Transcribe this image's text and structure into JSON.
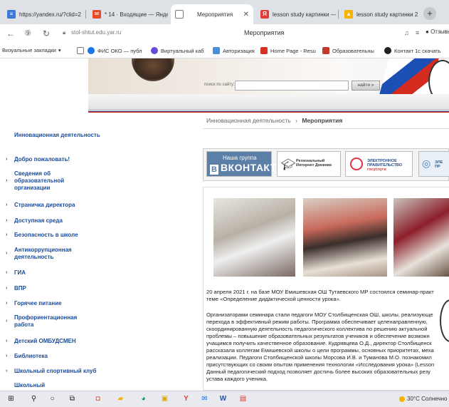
{
  "browser": {
    "tabs": [
      {
        "label": "https://yandex.ru/?clid=2",
        "icon": "yandex-url-icon"
      },
      {
        "label": "* 14 · Входящие — Яндек",
        "icon": "yandex-mail-icon"
      },
      {
        "label": "Мероприятия",
        "icon": "page-icon",
        "active": true
      },
      {
        "label": "lesson study картинки —",
        "icon": "yandex-search-icon"
      },
      {
        "label": "lesson study картинки 2",
        "icon": "yandex-images-icon"
      }
    ],
    "new_tab": "+",
    "url": "stol-shtut.edu.yar.ru",
    "page_title": "Мероприятия",
    "reviews_label": "Отзывы",
    "bookmarks": [
      {
        "label": "Визуальные закладки",
        "color": "#555555"
      },
      {
        "label": "ФИС ОКО — публ",
        "color": "#1a73e8"
      },
      {
        "label": "Виртуальный каб",
        "color": "#6a4ad8"
      },
      {
        "label": "Авторизация",
        "color": "#4a90d9"
      },
      {
        "label": "Home Page - Resu",
        "color": "#d93025"
      },
      {
        "label": "Образовательны",
        "color": "#c0392b"
      },
      {
        "label": "Контакт 1с скачать",
        "color": "#222222"
      }
    ]
  },
  "site": {
    "search_label": "поиск по сайту:",
    "search_button": "найти »",
    "breadcrumb": {
      "parent": "Инновационная деятельность",
      "sep": "›",
      "current": "Мероприятия"
    },
    "sidebar": [
      "Инновационная деятельность",
      "Добро пожаловать!",
      "Сведения об образовательной организации",
      "Страничка директора",
      "Доступная среда",
      "Безопасность в школе",
      "Антикоррупционная деятельность",
      "ГИА",
      "ВПР",
      "Горячее питание",
      "Профориентационная работа",
      "Детский ОМБУДСМЕН",
      "Библиотека",
      "Школьный спортивный клуб",
      "Школьный"
    ],
    "banners": {
      "vk_line1": "Наша группа",
      "vk_line2": "ВКОНТАКТЕ",
      "vk_letter": "В",
      "diary": "Региональный Интернет Дневник",
      "egov_1": "ЭЛЕКТРОННОЕ",
      "egov_2": "ПРАВИТЕЛЬСТВО",
      "egov_3": "госуслуги",
      "gos": "ЭЛЕ ПР"
    },
    "article": [
      "20 апреля 2021 г. на базе МОУ Емишевская ОШ Тутаевского МР состоялся семинар-практ",
      "теме «Определение дидактической ценности урока».",
      "",
      "Организаторами семинара стали педагоги МОУ Столбищенская ОШ, школы, реализующе",
      "перехода в эффективный режим работы. Программа обеспечивает целенаправленную,",
      "скоординированную деятельность педагогического коллектива по решению актуальной",
      "проблемы – повышение образовательных результатов учеников и обеспечение возможн",
      "учащимся получить качественное образование. Кудрявцева О.Д., директор Столбищенск",
      "рассказала коллегам Емишевской школы о цели программы, основных приоритетах, меха",
      "реализации.  Педагоги Столбищенской школы Морсова И.В. и Туманова М.О. познакомил",
      "присутствующих со своим опытом применения технологии «Исследования урока» (Lesson",
      "Данный педагогический подход позволяет достичь более высоких образовательных резу",
      "устава каждого ученика."
    ]
  },
  "taskbar": {
    "icons": [
      "windows-start-icon",
      "search-icon",
      "cortana-icon",
      "task-view-icon",
      "office-icon",
      "explorer-icon",
      "edge-icon",
      "store-icon",
      "yandex-icon",
      "mail-icon",
      "word-icon",
      "paint-icon"
    ],
    "weather": "30°C Солнечно"
  }
}
